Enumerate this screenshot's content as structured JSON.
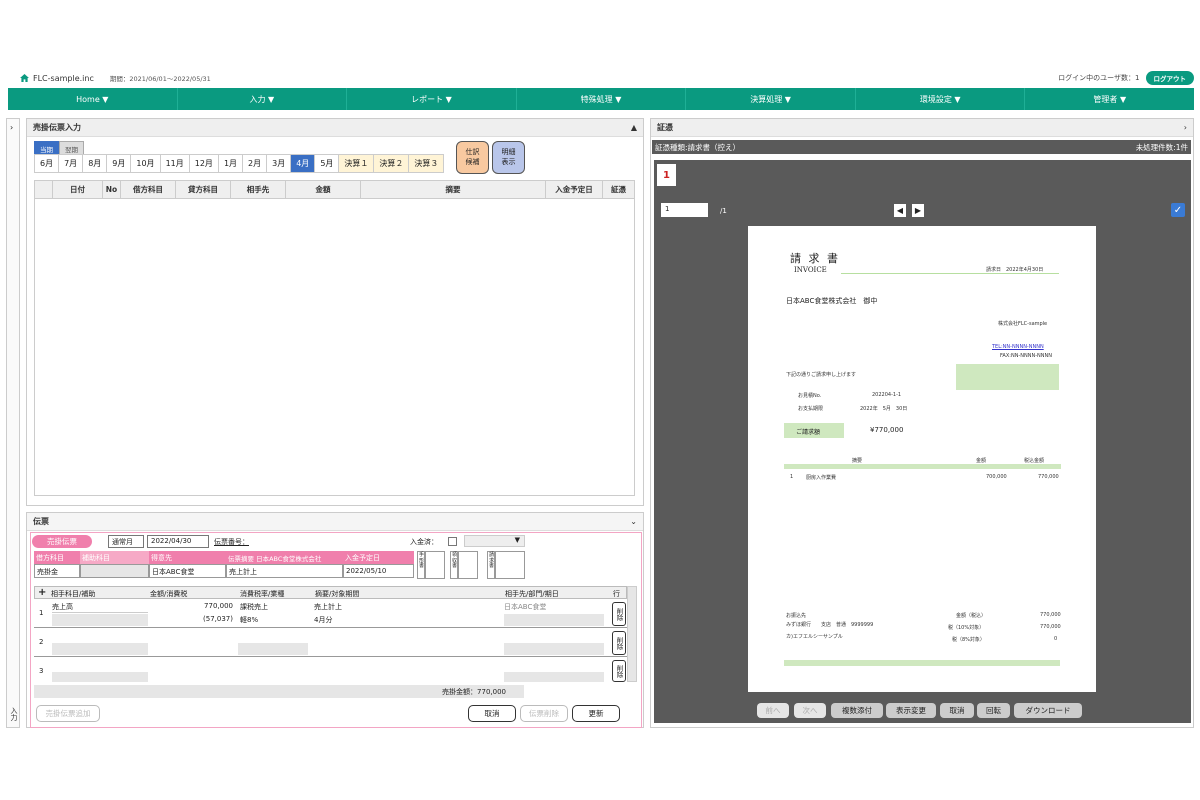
{
  "app": {
    "name": "FLC-sample.inc",
    "period": "期間：2021/06/01～2022/05/31",
    "users": "ログイン中のユーザ数：1",
    "logout": "ログアウト"
  },
  "nav": [
    "Home ▼",
    "入力 ▼",
    "レポート ▼",
    "特殊処理 ▼",
    "決算処理 ▼",
    "環境設定 ▼",
    "管理者 ▼"
  ],
  "left": {
    "title": "売掛伝票入力",
    "rail_label": "入力",
    "tabs": [
      "当期",
      "翌期"
    ],
    "months": [
      "6月",
      "7月",
      "8月",
      "9月",
      "10月",
      "11月",
      "12月",
      "1月",
      "2月",
      "3月",
      "4月",
      "5月",
      "決算１",
      "決算２",
      "決算３"
    ],
    "btn_candidate": "仕訳\n候補",
    "btn_detail": "明細\n表示",
    "columns": [
      "日付",
      "No",
      "借方科目",
      "貸方科目",
      "相手先",
      "金額",
      "摘要",
      "入金予定日",
      "証憑"
    ]
  },
  "voucher": {
    "title": "伝票",
    "type": "売掛伝票",
    "month_type": "通常月",
    "date": "2022/04/30",
    "number_label": "伝票番号：",
    "received_label": "入金済：",
    "hdr": [
      "借方科目",
      "補助科目",
      "得意先",
      "伝票摘要 日本ABC食堂株式会社",
      "入金予定日"
    ],
    "vals": [
      "売掛金",
      "",
      "日本ABC食堂",
      "売上計上",
      "2022/05/10"
    ],
    "side": [
      "手形書",
      "領収書",
      "請求書"
    ],
    "lcols": [
      "相手科目/補助",
      "金額/消費税",
      "消費税率/業種",
      "摘要/対象期間",
      "相手先/部門/期日",
      "行"
    ],
    "row1": {
      "no": "1",
      "acct": "売上高",
      "amt": "770,000",
      "tax_type": "課税売上",
      "desc": "売上計上",
      "partner": "日本ABC食堂",
      "tax": "(57,037)",
      "rate": "軽8%",
      "period": "4月分"
    },
    "row_nums": [
      "2",
      "3"
    ],
    "del": "削除",
    "total": "売掛金額：770,000",
    "btn_add": "売掛伝票追加",
    "btn_cancel": "取消",
    "btn_del": "伝票削除",
    "btn_update": "更新"
  },
  "evidence": {
    "title": "証憑",
    "type": "証憑種類:請求書（控え）",
    "pending": "未処理件数:1件",
    "page": "1",
    "page_input": "1",
    "page_total": "/1",
    "doc": {
      "title_jp": "請 求 書",
      "title_en": "INVOICE",
      "date": "請求日　2022年4月30日",
      "to": "日本ABC食堂株式会社　御中",
      "from": "株式会社FLC-sample",
      "tel": "TEL:NN-NNNN-NNNN",
      "fax": "FAX:NN-NNNN-NNNN",
      "intro": "下記の通りご請求申し上げます",
      "l1": "お見積No.",
      "v1": "202204-1-1",
      "l2": "お支払期限",
      "v2": "2022年　5月　30日",
      "amt_label": "ご請求額",
      "amt": "¥770,000",
      "c_desc": "摘要",
      "c_amt": "金額",
      "c_tax": "税込金額",
      "item_no": "1",
      "item": "厨房入作業費",
      "item_amt": "700,000",
      "item_total": "770,000",
      "bank_title": "お振込先",
      "bank": "みずほ銀行　　支店　普通　9999999",
      "acct_name": "カ)エフエルシーサンプル",
      "sum1_l": "金額（税込）",
      "sum1": "770,000",
      "sum2_l": "税（10%対象）",
      "sum2": "770,000",
      "sum3_l": "税（8%対象）",
      "sum3": "0"
    },
    "buttons": [
      "前へ",
      "次へ",
      "複数添付",
      "表示変更",
      "取消",
      "回転",
      "ダウンロード"
    ]
  }
}
